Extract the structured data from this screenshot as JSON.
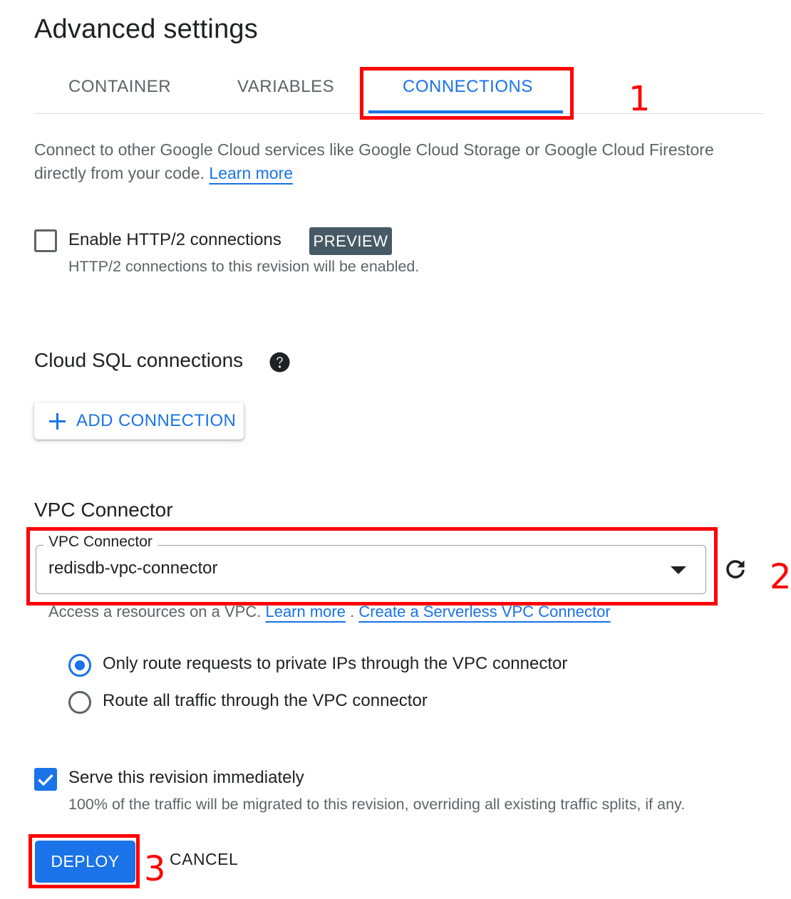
{
  "page": {
    "title": "Advanced settings"
  },
  "tabs": [
    {
      "label": "CONTAINER",
      "active": false
    },
    {
      "label": "VARIABLES",
      "active": false
    },
    {
      "label": "CONNECTIONS",
      "active": true
    }
  ],
  "intro": {
    "text": "Connect to other Google Cloud services like Google Cloud Storage or Google Cloud Firestore directly from your code. ",
    "link": "Learn more"
  },
  "http2": {
    "label": "Enable HTTP/2 connections",
    "badge": "PREVIEW",
    "helper": "HTTP/2 connections to this revision will be enabled.",
    "checked": false
  },
  "cloud_sql": {
    "heading": "Cloud SQL connections",
    "help_icon": "help-circle-icon",
    "add_button": "ADD CONNECTION",
    "add_icon": "plus-icon"
  },
  "vpc": {
    "heading": "VPC Connector",
    "field_label": "VPC Connector",
    "selected_value": "redisdb-vpc-connector",
    "helper_text": "Access a resources on a VPC. ",
    "learn_more": "Learn more",
    "separator": " . ",
    "create_link": "Create a Serverless VPC Connector",
    "refresh_icon": "refresh-icon",
    "routing_options": [
      {
        "label": "Only route requests to private IPs through the VPC connector",
        "selected": true
      },
      {
        "label": "Route all traffic through the VPC connector",
        "selected": false
      }
    ]
  },
  "serve": {
    "label": "Serve this revision immediately",
    "helper": "100% of the traffic will be migrated to this revision, overriding all existing traffic splits, if any.",
    "checked": true
  },
  "actions": {
    "deploy": "DEPLOY",
    "cancel": "CANCEL"
  },
  "annotations": {
    "step1": "1",
    "step2": "2",
    "step3": "3"
  },
  "colors": {
    "accent": "#1a73e8",
    "annotation": "#ff0000",
    "badge_bg": "#455a64"
  }
}
